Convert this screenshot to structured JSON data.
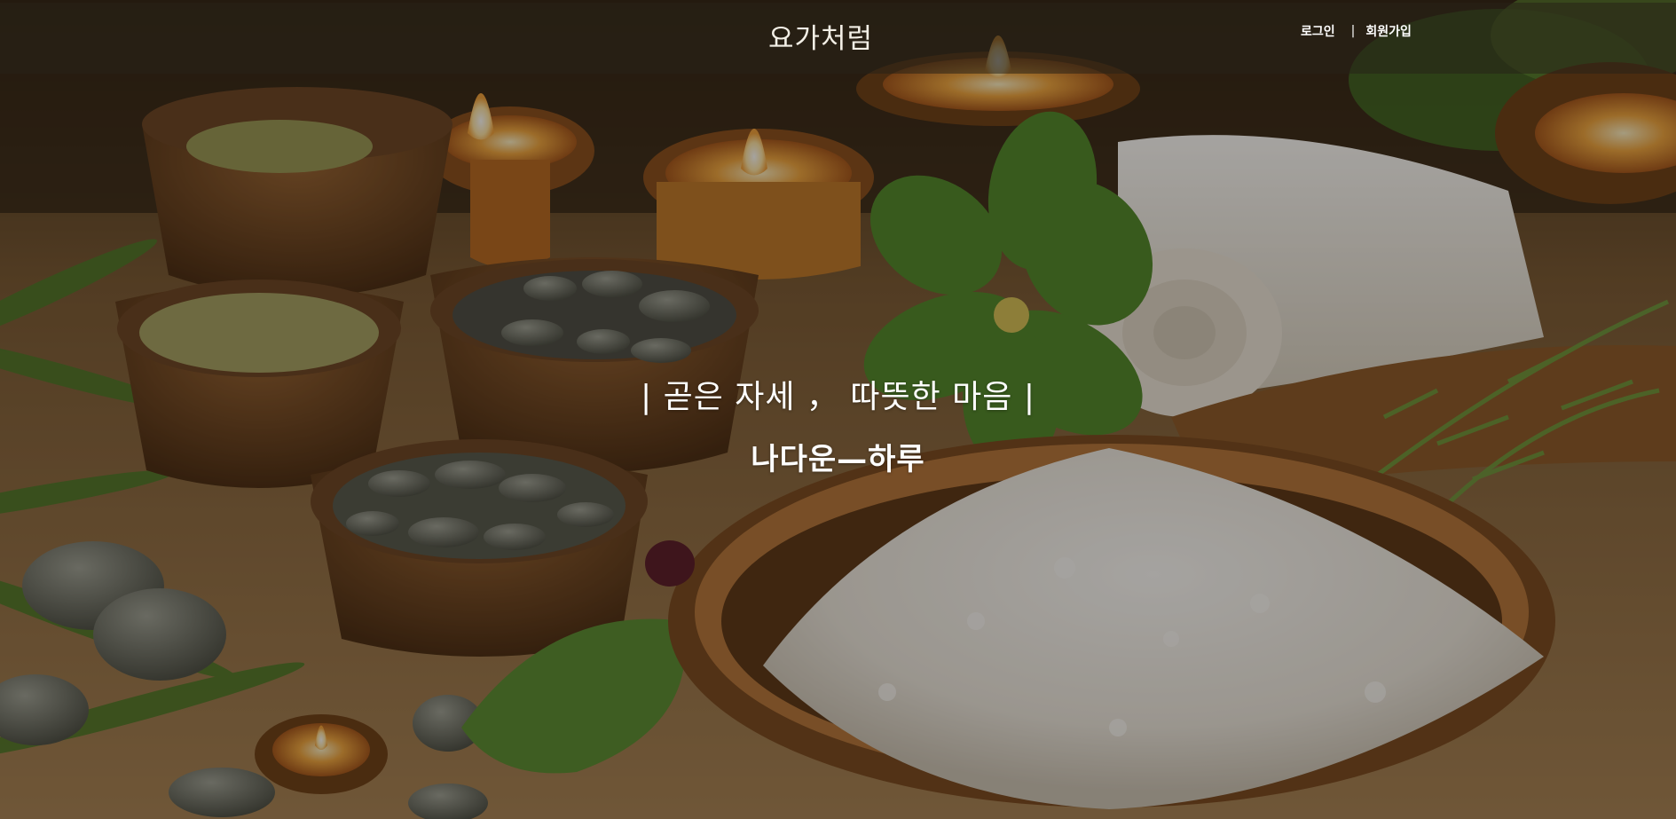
{
  "header": {
    "logo_text": "요가처럼",
    "nav": {
      "login_label": "로그인",
      "divider": "|",
      "signup_label": "회원가입"
    }
  },
  "hero": {
    "tagline": "| 곧은 자세 ， 따뜻한 마음 |",
    "subline": "나다운—하루",
    "background": {
      "description_icon": "spa-still-life-image",
      "tone_colors": [
        "#c9893f",
        "#6b4a2a",
        "#f5f1ea",
        "#4f7d2c"
      ]
    }
  }
}
